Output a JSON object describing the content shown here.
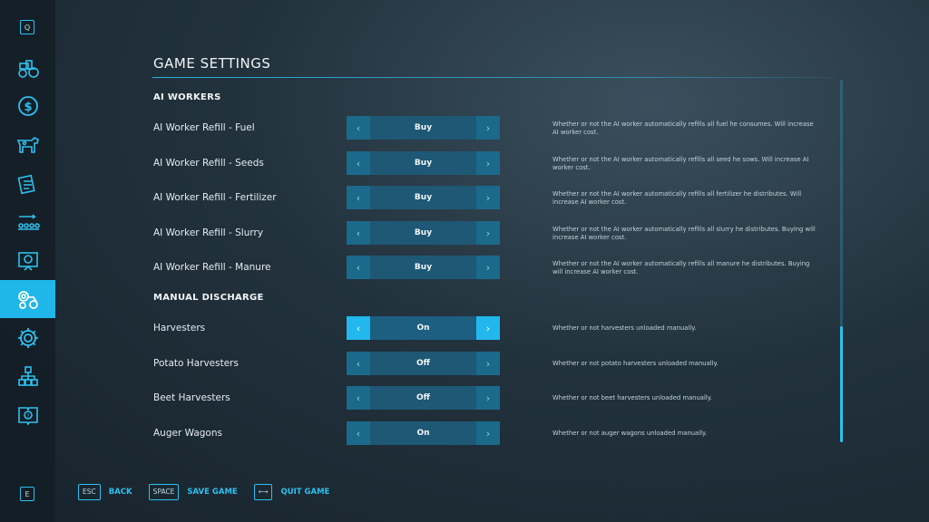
{
  "sidebar": {
    "top_key": "Q",
    "bottom_key": "E",
    "items": [
      {
        "icon": "tractor-icon",
        "active": false
      },
      {
        "icon": "dollar-icon",
        "active": false
      },
      {
        "icon": "cow-icon",
        "active": false
      },
      {
        "icon": "contracts-icon",
        "active": false
      },
      {
        "icon": "production-chain-icon",
        "active": false
      },
      {
        "icon": "statistics-icon",
        "active": false
      },
      {
        "icon": "vehicle-settings-icon",
        "active": true
      },
      {
        "icon": "gear-icon",
        "active": false
      },
      {
        "icon": "hierarchy-icon",
        "active": false
      },
      {
        "icon": "help-book-icon",
        "active": false
      }
    ]
  },
  "page": {
    "title": "GAME SETTINGS",
    "accent_color": "#2ec0ef"
  },
  "sections": [
    {
      "title": "AI WORKERS"
    },
    {
      "title": "MANUAL DISCHARGE"
    }
  ],
  "settings": [
    {
      "label": "AI Worker Refill - Fuel",
      "value": "Buy",
      "desc": "Whether or not the AI worker automatically refills all fuel he consumes. Will increase AI worker cost."
    },
    {
      "label": "AI Worker Refill - Seeds",
      "value": "Buy",
      "desc": "Whether or not the AI worker automatically refills all seed he sows. Will increase AI worker cost."
    },
    {
      "label": "AI Worker Refill - Fertilizer",
      "value": "Buy",
      "desc": "Whether or not the AI worker automatically refills all fertilizer he distributes. Will increase AI worker cost."
    },
    {
      "label": "AI Worker Refill - Slurry",
      "value": "Buy",
      "desc": "Whether or not the AI worker automatically refills all slurry he distributes. Buying will increase AI worker cost."
    },
    {
      "label": "AI Worker Refill - Manure",
      "value": "Buy",
      "desc": "Whether or not the AI worker automatically refills all manure he distributes. Buying will increase AI worker cost."
    },
    {
      "label": "Harvesters",
      "value": "On",
      "desc": "Whether or not harvesters unloaded manually."
    },
    {
      "label": "Potato Harvesters",
      "value": "Off",
      "desc": "Whether or not potato harvesters unloaded manually."
    },
    {
      "label": "Beet Harvesters",
      "value": "Off",
      "desc": "Whether or not beet harvesters unloaded manually."
    },
    {
      "label": "Auger Wagons",
      "value": "On",
      "desc": "Whether or not auger wagons unloaded manually."
    }
  ],
  "arrows": {
    "left": "‹",
    "right": "›"
  },
  "footer": [
    {
      "key": "ESC",
      "label": "BACK"
    },
    {
      "key": "SPACE",
      "label": "SAVE GAME"
    },
    {
      "key": "⟷",
      "label": "QUIT GAME"
    }
  ]
}
